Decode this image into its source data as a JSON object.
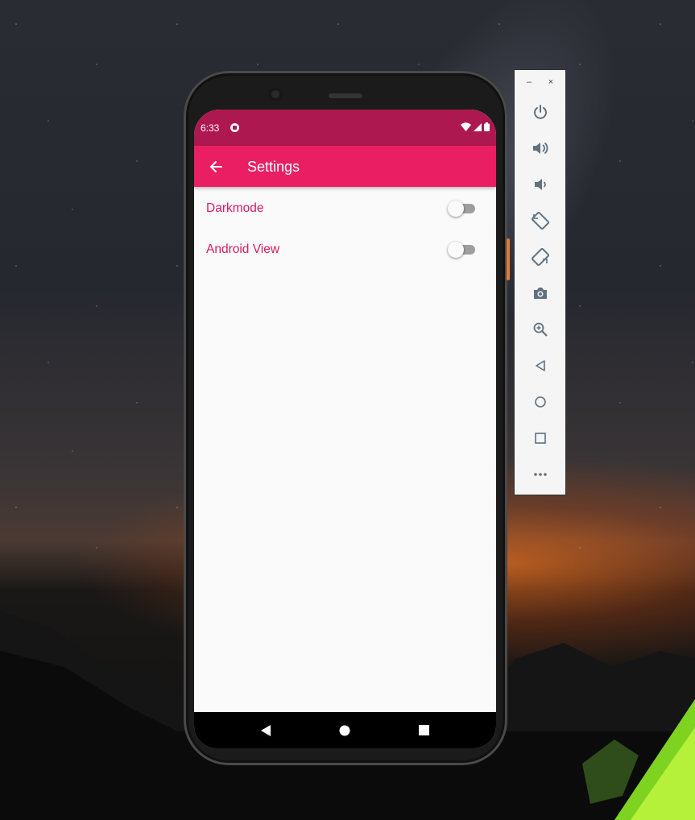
{
  "status_bar": {
    "time": "6:33"
  },
  "app_bar": {
    "title": "Settings"
  },
  "settings": [
    {
      "label": "Darkmode",
      "enabled": false
    },
    {
      "label": "Android View",
      "enabled": false
    }
  ],
  "colors": {
    "primary": "#e91e63",
    "primary_dark": "#ad1850",
    "accent_text": "#d81b60",
    "background": "#fafafa"
  },
  "nav_bar": {
    "icons": [
      "back-triangle-icon",
      "home-circle-icon",
      "recents-square-icon"
    ]
  },
  "emulator_toolbar": {
    "window_controls": {
      "minimize": "–",
      "close": "×"
    },
    "buttons": [
      "power-icon",
      "volume-up-icon",
      "volume-down-icon",
      "rotate-left-icon",
      "rotate-right-icon",
      "camera-icon",
      "zoom-icon",
      "back-icon",
      "home-icon",
      "overview-icon",
      "more-icon"
    ]
  }
}
